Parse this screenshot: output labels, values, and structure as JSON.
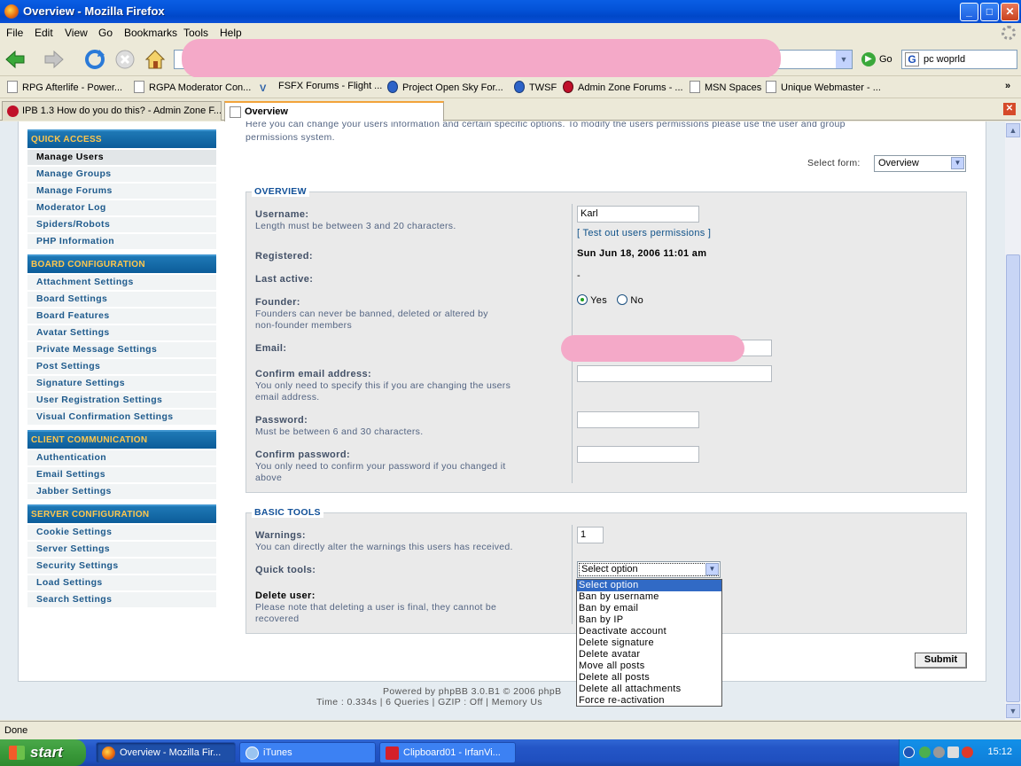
{
  "window": {
    "title": "Overview - Mozilla Firefox",
    "minimize": "_",
    "maximize": "□",
    "close": "✕"
  },
  "menu": [
    "File",
    "Edit",
    "View",
    "Go",
    "Bookmarks",
    "Tools",
    "Help"
  ],
  "nav": {
    "go_label": "Go",
    "search_value": "pc woprld"
  },
  "bookmarks": [
    "RPG Afterlife - Power...",
    "RGPA Moderator Con...",
    "FSFX Forums - Flight ...",
    "Project Open Sky For...",
    "TWSF",
    "Admin Zone Forums - ...",
    "MSN Spaces",
    "Unique Webmaster - ..."
  ],
  "bookmarks_more": "»",
  "tabs": [
    "IPB 1.3 How do you do this? - Admin Zone F...",
    "Overview"
  ],
  "sidebar": {
    "sections": [
      {
        "title": "QUICK ACCESS",
        "items": [
          "Manage Users",
          "Manage Groups",
          "Manage Forums",
          "Moderator Log",
          "Spiders/Robots",
          "PHP Information"
        ]
      },
      {
        "title": "BOARD CONFIGURATION",
        "items": [
          "Attachment Settings",
          "Board Settings",
          "Board Features",
          "Avatar Settings",
          "Private Message Settings",
          "Post Settings",
          "Signature Settings",
          "User Registration Settings",
          "Visual Confirmation Settings"
        ]
      },
      {
        "title": "CLIENT COMMUNICATION",
        "items": [
          "Authentication",
          "Email Settings",
          "Jabber Settings"
        ]
      },
      {
        "title": "SERVER CONFIGURATION",
        "items": [
          "Cookie Settings",
          "Server Settings",
          "Security Settings",
          "Load Settings",
          "Search Settings"
        ]
      }
    ]
  },
  "intro": {
    "line1": "Here you can change your users information and certain specific options. To modify the users permissions please use the user and group",
    "line2": "permissions system."
  },
  "select_form": {
    "label": "Select form:",
    "value": "Overview"
  },
  "overview": {
    "legend": "OVERVIEW",
    "username": {
      "label": "Username:",
      "hint": "Length must be between 3 and 20 characters.",
      "value": "Karl",
      "link": "Test out users permissions",
      "bracket_open": "[",
      "bracket_close": "]"
    },
    "registered": {
      "label": "Registered:",
      "value": "Sun Jun 18, 2006 11:01 am"
    },
    "last_active": {
      "label": "Last active:",
      "value": "-"
    },
    "founder": {
      "label": "Founder:",
      "hint1": "Founders can never be banned, deleted or altered by",
      "hint2": "non-founder members",
      "yes": "Yes",
      "no": "No",
      "selected": "Yes"
    },
    "email": {
      "label": "Email:"
    },
    "confirm_email": {
      "label": "Confirm email address:",
      "hint1": "You only need to specify this if you are changing the users",
      "hint2": "email address."
    },
    "password": {
      "label": "Password:",
      "hint": "Must be between 6 and 30 characters."
    },
    "confirm_password": {
      "label": "Confirm password:",
      "hint1": "You only need to confirm your password if you changed it",
      "hint2": "above"
    }
  },
  "basic_tools": {
    "legend": "BASIC TOOLS",
    "warnings": {
      "label": "Warnings:",
      "hint": "You can directly alter the warnings this users has received.",
      "value": "1"
    },
    "quick_tools": {
      "label": "Quick tools:",
      "value": "Select option",
      "options": [
        "Select option",
        "Ban by username",
        "Ban by email",
        "Ban by IP",
        "Deactivate account",
        "Delete signature",
        "Delete avatar",
        "Move all posts",
        "Delete all posts",
        "Delete all attachments",
        "Force re-activation"
      ]
    },
    "delete_user": {
      "label": "Delete user:",
      "hint1": "Please note that deleting a user is final, they cannot be",
      "hint2": "recovered"
    }
  },
  "submit_label": "Submit",
  "footer": {
    "line1": "Powered by phpBB 3.0.B1 © 2006 phpB",
    "line2": "Time : 0.334s | 6 Queries | GZIP : Off | Memory Us"
  },
  "status": "Done",
  "taskbar": {
    "start": "start",
    "tasks": [
      "Overview - Mozilla Fir...",
      "iTunes",
      "Clipboard01 - IrfanVi..."
    ],
    "clock": "15:12"
  }
}
